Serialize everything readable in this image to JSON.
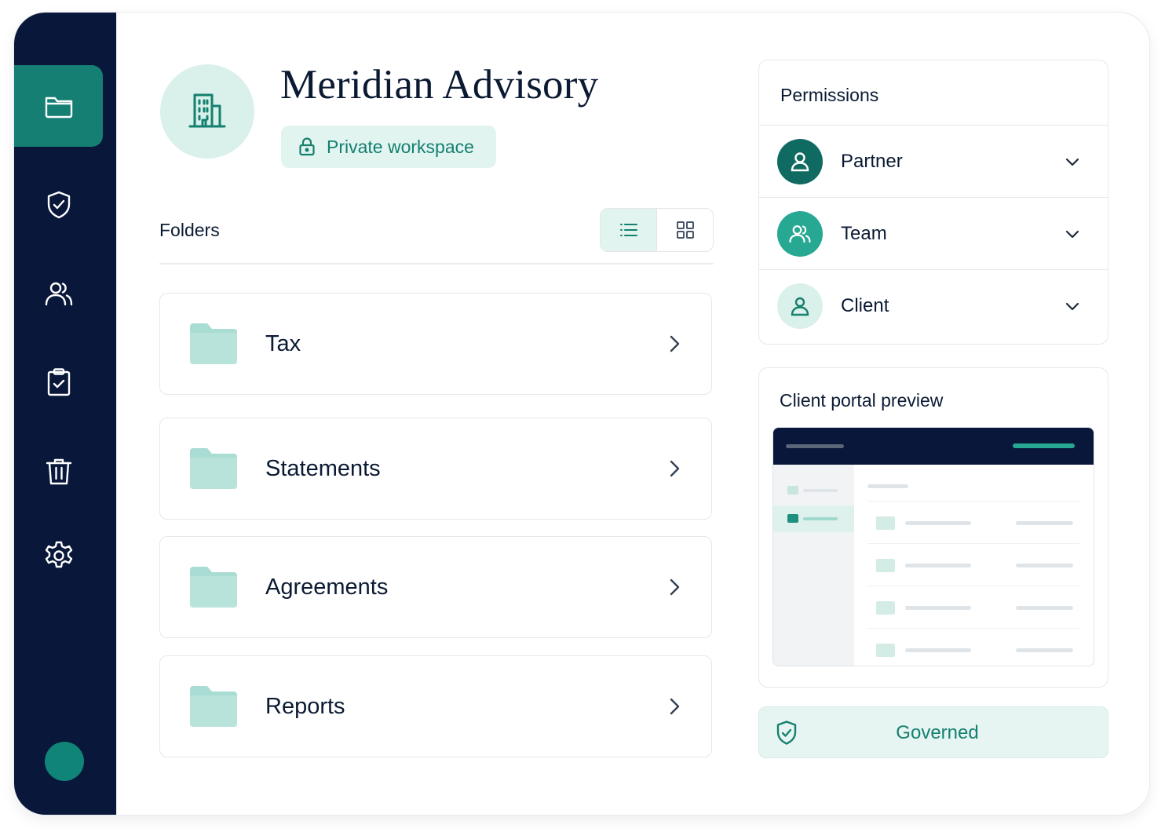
{
  "workspace": {
    "title": "Meridian Advisory",
    "badge": "Private workspace"
  },
  "sidebar": {
    "items": [
      {
        "icon": "folder-icon",
        "active": true
      },
      {
        "icon": "shield-check-icon",
        "active": false
      },
      {
        "icon": "users-icon",
        "active": false
      },
      {
        "icon": "clipboard-check-icon",
        "active": false
      },
      {
        "icon": "trash-icon",
        "active": false
      },
      {
        "icon": "gear-icon",
        "active": false
      }
    ]
  },
  "folders": {
    "label": "Folders",
    "view": "list",
    "items": [
      {
        "name": "Tax"
      },
      {
        "name": "Statements"
      },
      {
        "name": "Agreements"
      },
      {
        "name": "Reports"
      }
    ]
  },
  "permissions": {
    "title": "Permissions",
    "roles": [
      {
        "label": "Partner"
      },
      {
        "label": "Team"
      },
      {
        "label": "Client"
      }
    ]
  },
  "preview": {
    "title": "Client portal preview"
  },
  "governed": {
    "label": "Governed"
  },
  "colors": {
    "sidebar": "#08173a",
    "accent": "#157f73",
    "accent_light": "#e2f4f0",
    "folder": "#a9dcd3"
  }
}
